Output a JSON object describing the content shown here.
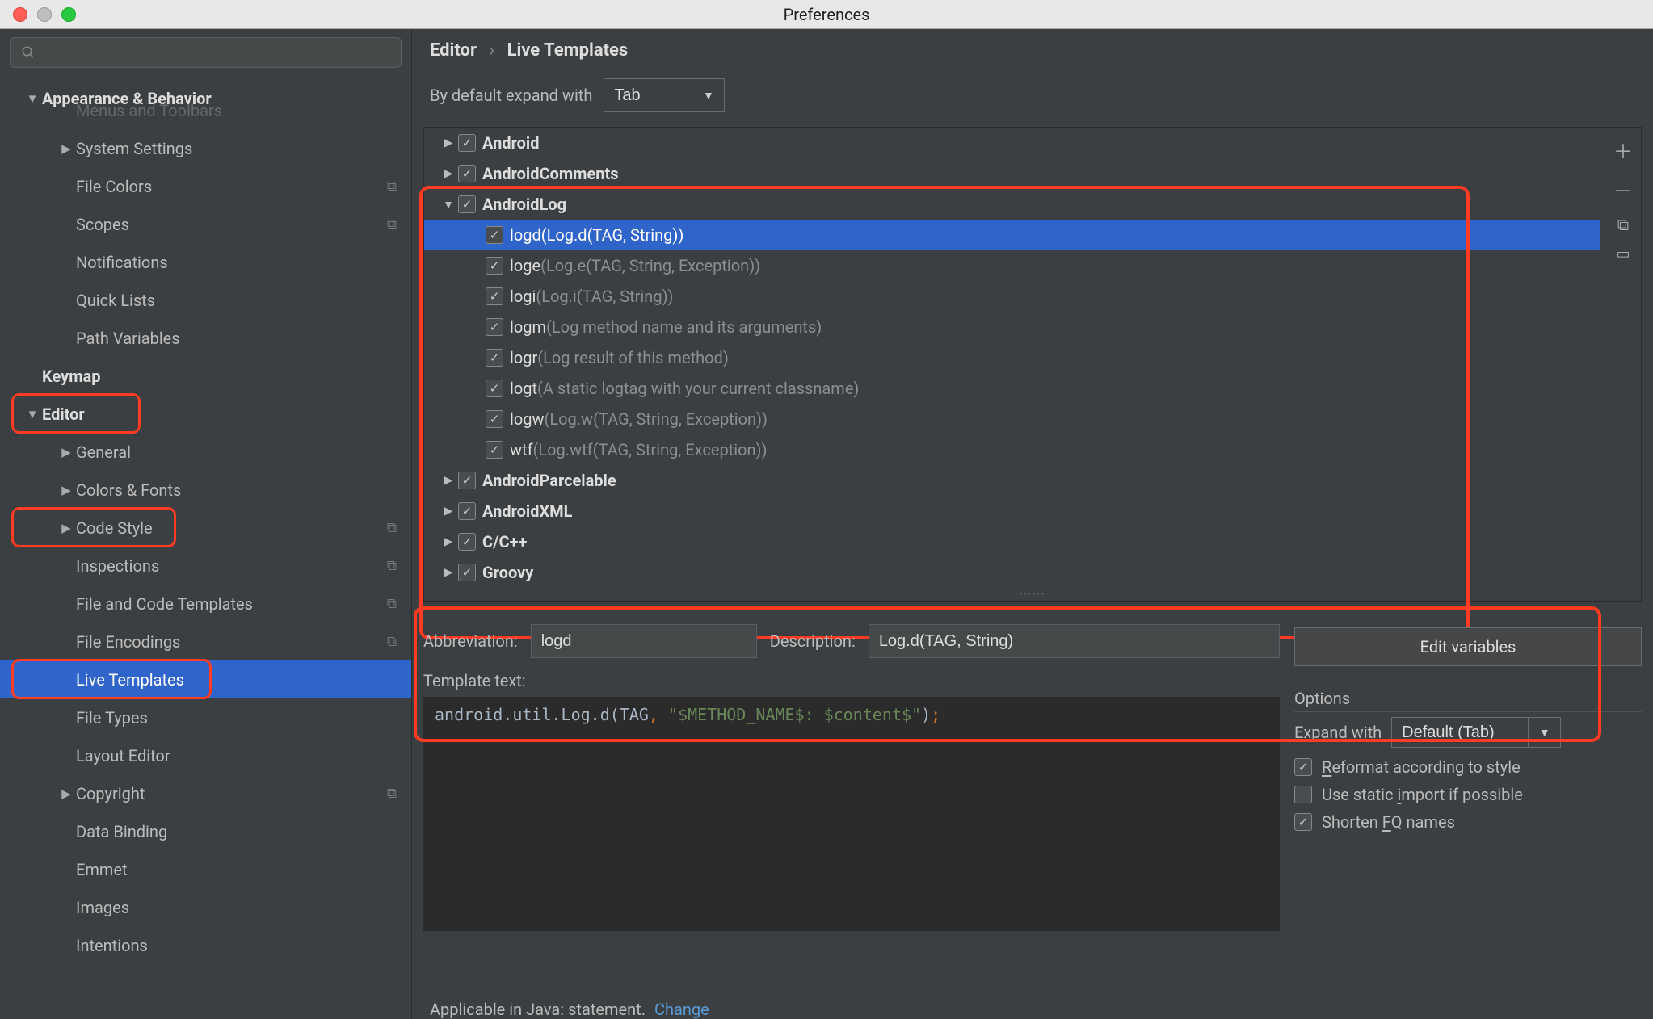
{
  "window": {
    "title": "Preferences"
  },
  "sidebar": {
    "search_placeholder": "",
    "items": [
      {
        "id": "appearance",
        "label": "Appearance & Behavior",
        "bold": true,
        "level": 0,
        "arrow": "down"
      },
      {
        "id": "menus",
        "label": "Menus and Toolbars",
        "dim": true,
        "level": 1
      },
      {
        "id": "syssettings",
        "label": "System Settings",
        "level": 1,
        "arrow": "right"
      },
      {
        "id": "filecolors",
        "label": "File Colors",
        "level": 1,
        "copy": true
      },
      {
        "id": "scopes",
        "label": "Scopes",
        "level": 1,
        "copy": true
      },
      {
        "id": "notif",
        "label": "Notifications",
        "level": 1
      },
      {
        "id": "quicklists",
        "label": "Quick Lists",
        "level": 1
      },
      {
        "id": "pathvars",
        "label": "Path Variables",
        "level": 1
      },
      {
        "id": "keymap",
        "label": "Keymap",
        "bold": true,
        "level": 0
      },
      {
        "id": "editor",
        "label": "Editor",
        "bold": true,
        "level": 0,
        "arrow": "down",
        "red": true
      },
      {
        "id": "general",
        "label": "General",
        "level": 1,
        "arrow": "right"
      },
      {
        "id": "colorsfonts",
        "label": "Colors & Fonts",
        "level": 1,
        "arrow": "right"
      },
      {
        "id": "codestyle",
        "label": "Code Style",
        "level": 1,
        "arrow": "right",
        "copy": true,
        "red": true
      },
      {
        "id": "inspections",
        "label": "Inspections",
        "level": 1,
        "copy": true
      },
      {
        "id": "filetemplates",
        "label": "File and Code Templates",
        "level": 1,
        "copy": true
      },
      {
        "id": "fileenc",
        "label": "File Encodings",
        "level": 1,
        "copy": true
      },
      {
        "id": "livetmpl",
        "label": "Live Templates",
        "level": 1,
        "selected": true,
        "red": true
      },
      {
        "id": "filetypes",
        "label": "File Types",
        "level": 1
      },
      {
        "id": "layouteditor",
        "label": "Layout Editor",
        "level": 1
      },
      {
        "id": "copyright",
        "label": "Copyright",
        "level": 1,
        "arrow": "right",
        "copy": true
      },
      {
        "id": "databinding",
        "label": "Data Binding",
        "level": 1
      },
      {
        "id": "emmet",
        "label": "Emmet",
        "level": 1
      },
      {
        "id": "images",
        "label": "Images",
        "level": 1
      },
      {
        "id": "intentions",
        "label": "Intentions",
        "level": 1
      }
    ]
  },
  "breadcrumb": {
    "root": "Editor",
    "leaf": "Live Templates"
  },
  "expand": {
    "label": "By default expand with",
    "value": "Tab"
  },
  "templates": {
    "groups": [
      {
        "name": "Android",
        "expanded": false,
        "children": []
      },
      {
        "name": "AndroidComments",
        "expanded": false,
        "children": []
      },
      {
        "name": "AndroidLog",
        "expanded": true,
        "red": true,
        "children": [
          {
            "abbr": "logd",
            "desc": "(Log.d(TAG, String))",
            "selected": true
          },
          {
            "abbr": "loge",
            "desc": "(Log.e(TAG, String, Exception))"
          },
          {
            "abbr": "logi",
            "desc": "(Log.i(TAG, String))"
          },
          {
            "abbr": "logm",
            "desc": "(Log method name and its arguments)"
          },
          {
            "abbr": "logr",
            "desc": "(Log result of this method)"
          },
          {
            "abbr": "logt",
            "desc": "(A static logtag with your current classname)"
          },
          {
            "abbr": "logw",
            "desc": "(Log.w(TAG, String, Exception))"
          },
          {
            "abbr": "wtf",
            "desc": "(Log.wtf(TAG, String, Exception))"
          }
        ]
      },
      {
        "name": "AndroidParcelable",
        "expanded": false,
        "children": []
      },
      {
        "name": "AndroidXML",
        "expanded": false,
        "children": []
      },
      {
        "name": "C/C++",
        "expanded": false,
        "children": []
      },
      {
        "name": "Groovy",
        "expanded": false,
        "children": []
      }
    ]
  },
  "detail": {
    "abbr_label": "Abbreviation:",
    "abbr_value": "logd",
    "desc_label": "Description:",
    "desc_value": "Log.d(TAG, String)",
    "tt_label": "Template text:",
    "tt_code_plain": "android.util.Log.d(TAG, \"$METHOD_NAME$: $content$\");",
    "editvars": "Edit variables",
    "options_label": "Options",
    "expandwith_label": "Expand with",
    "expandwith_value": "Default (Tab)",
    "opt_reformat": "Reformat according to style",
    "opt_static": "Use static import if possible",
    "opt_shorten": "Shorten FQ names",
    "applicable_prefix": "Applicable in Java: statement.",
    "applicable_change": "Change"
  }
}
